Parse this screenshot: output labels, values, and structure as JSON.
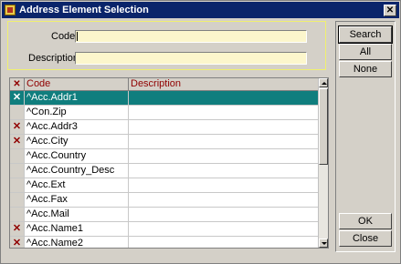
{
  "window": {
    "title": "Address Element Selection",
    "close_glyph": "✕"
  },
  "search": {
    "code_label": "Code",
    "code_value": "",
    "description_label": "Description",
    "description_value": ""
  },
  "buttons": {
    "search": "Search",
    "all": "All",
    "none": "None",
    "ok": "OK",
    "close": "Close"
  },
  "grid": {
    "header_mark": "✕",
    "columns": [
      "Code",
      "Description"
    ],
    "rows": [
      {
        "selected": true,
        "marked": true,
        "code": "^Acc.Addr1",
        "description": ""
      },
      {
        "selected": false,
        "marked": false,
        "code": "^Con.Zip",
        "description": ""
      },
      {
        "selected": false,
        "marked": true,
        "code": "^Acc.Addr3",
        "description": ""
      },
      {
        "selected": false,
        "marked": true,
        "code": "^Acc.City",
        "description": ""
      },
      {
        "selected": false,
        "marked": false,
        "code": "^Acc.Country",
        "description": ""
      },
      {
        "selected": false,
        "marked": false,
        "code": "^Acc.Country_Desc",
        "description": ""
      },
      {
        "selected": false,
        "marked": false,
        "code": "^Acc.Ext",
        "description": ""
      },
      {
        "selected": false,
        "marked": false,
        "code": "^Acc.Fax",
        "description": ""
      },
      {
        "selected": false,
        "marked": false,
        "code": "^Acc.Mail",
        "description": ""
      },
      {
        "selected": false,
        "marked": true,
        "code": "^Acc.Name1",
        "description": ""
      },
      {
        "selected": false,
        "marked": true,
        "code": "^Acc.Name2",
        "description": ""
      }
    ]
  },
  "colors": {
    "titlebar": "#0a246a",
    "selection": "#107e7e",
    "field_bg": "#fcf6cc",
    "mark": "#900000"
  }
}
